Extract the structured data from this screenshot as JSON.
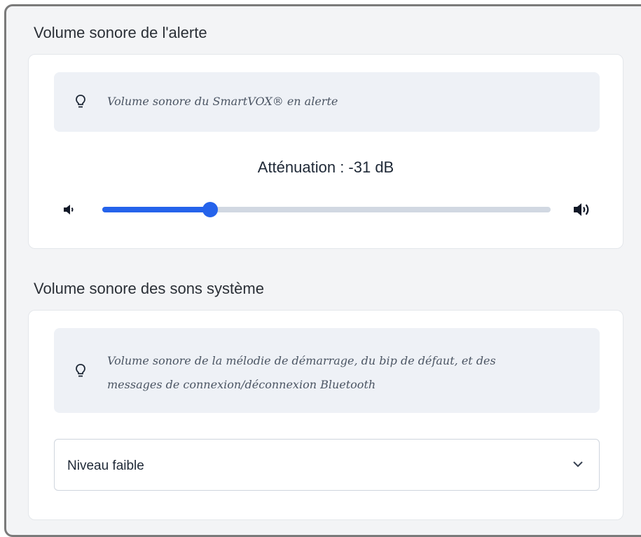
{
  "alert_section": {
    "title": "Volume sonore de l'alerte",
    "tip_icon": "lightbulb-icon",
    "tip_text": "Volume sonore du SmartVOX® en alerte",
    "attenuation_label": "Atténuation : -31 dB",
    "slider": {
      "value_fraction": 0.24,
      "min_icon": "volume-low-icon",
      "max_icon": "volume-high-icon"
    }
  },
  "system_section": {
    "title": "Volume sonore des sons système",
    "tip_icon": "lightbulb-icon",
    "tip_text_line1": "Volume sonore de la mélodie de démarrage, du bip de défaut, et des",
    "tip_text_line2": "messages de connexion/déconnexion Bluetooth",
    "select_value": "Niveau faible",
    "select_icon": "chevron-down-icon"
  },
  "colors": {
    "accent": "#2563eb",
    "track": "#d1d8e2",
    "panel_bg": "#f3f4f6",
    "tip_bg": "#eef1f6"
  }
}
